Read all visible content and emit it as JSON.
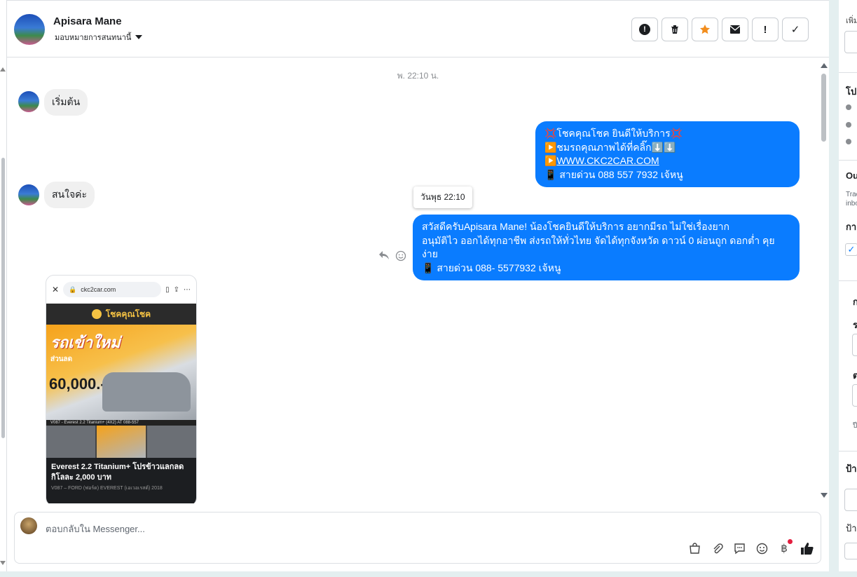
{
  "header": {
    "name": "Apisara Mane",
    "assign_label": "มอบหมายการสนทนานี้"
  },
  "toolbar": {
    "spam": "!",
    "mark": "!",
    "done": "✓"
  },
  "chat": {
    "timestamp": "พ. 22:10 น.",
    "msg_in_1": "เริ่มต้น",
    "msg_in_2": "สนใจค่ะ",
    "msg_out_1": {
      "line1": "💢โชคคุณโชค ยินดีให้บริการ💢",
      "line2_prefix": "▶️ชมรถคุณภาพได้ที่คลิ๊ก⬇️⬇️",
      "line2_link_prefix": "▶️",
      "link": "WWW.CKC2CAR.COM",
      "line3": "📱 สายด่วน 088 557 7932 เจ้หนู"
    },
    "tooltip": "วันพุธ 22:10",
    "msg_out_2": {
      "line1": "สวัสดีครับApisara Mane! น้องโชคยินดีให้บริการ อยากมีรถ ไม่ใช่เรื่องยาก",
      "line2": "อนุมัติไว ออกได้ทุกอาชีพ ส่งรถให้ทั่วไทย จัดได้ทุกจังหวัด ดาวน์ 0  ผ่อนถูก ดอกต่ำ คุยง่าย",
      "line3": "📱 สายด่วน 088- 5577932 เจ้หนู"
    },
    "card": {
      "url": "ckc2car.com",
      "site_name": "โชคคุณโชค",
      "headline": "รถเข้าใหม่",
      "subline": "ส่วนลด",
      "price": "60,000.-",
      "strip": "V087 - Everest 2.2 Titanium+ (4X2) AT   088-557",
      "caption": "Everest 2.2 Titanium+ โปรข้าวแลกลด กิโลละ 2,000 บาท",
      "caption_sub": "V087 – FORD (ฟอร์ด) EVEREST (เอเวอเรสต์) 2018"
    }
  },
  "composer": {
    "placeholder": "ตอบกลับใน Messenger..."
  },
  "right_panel": {
    "t1": "เพิ่ม",
    "t2": "โป",
    "t3": "Ou",
    "t3_sub1": "Trac",
    "t3_sub2": "inbo",
    "t4": "กา",
    "t5": "ก",
    "t6": "ร",
    "t7": "ต",
    "t8": "ปี",
    "t9": "ป้า",
    "t10": "ป้า"
  },
  "colors": {
    "accent": "#0a7cff",
    "incoming_bubble": "#f0f0f0",
    "star": "#f28d1d"
  }
}
